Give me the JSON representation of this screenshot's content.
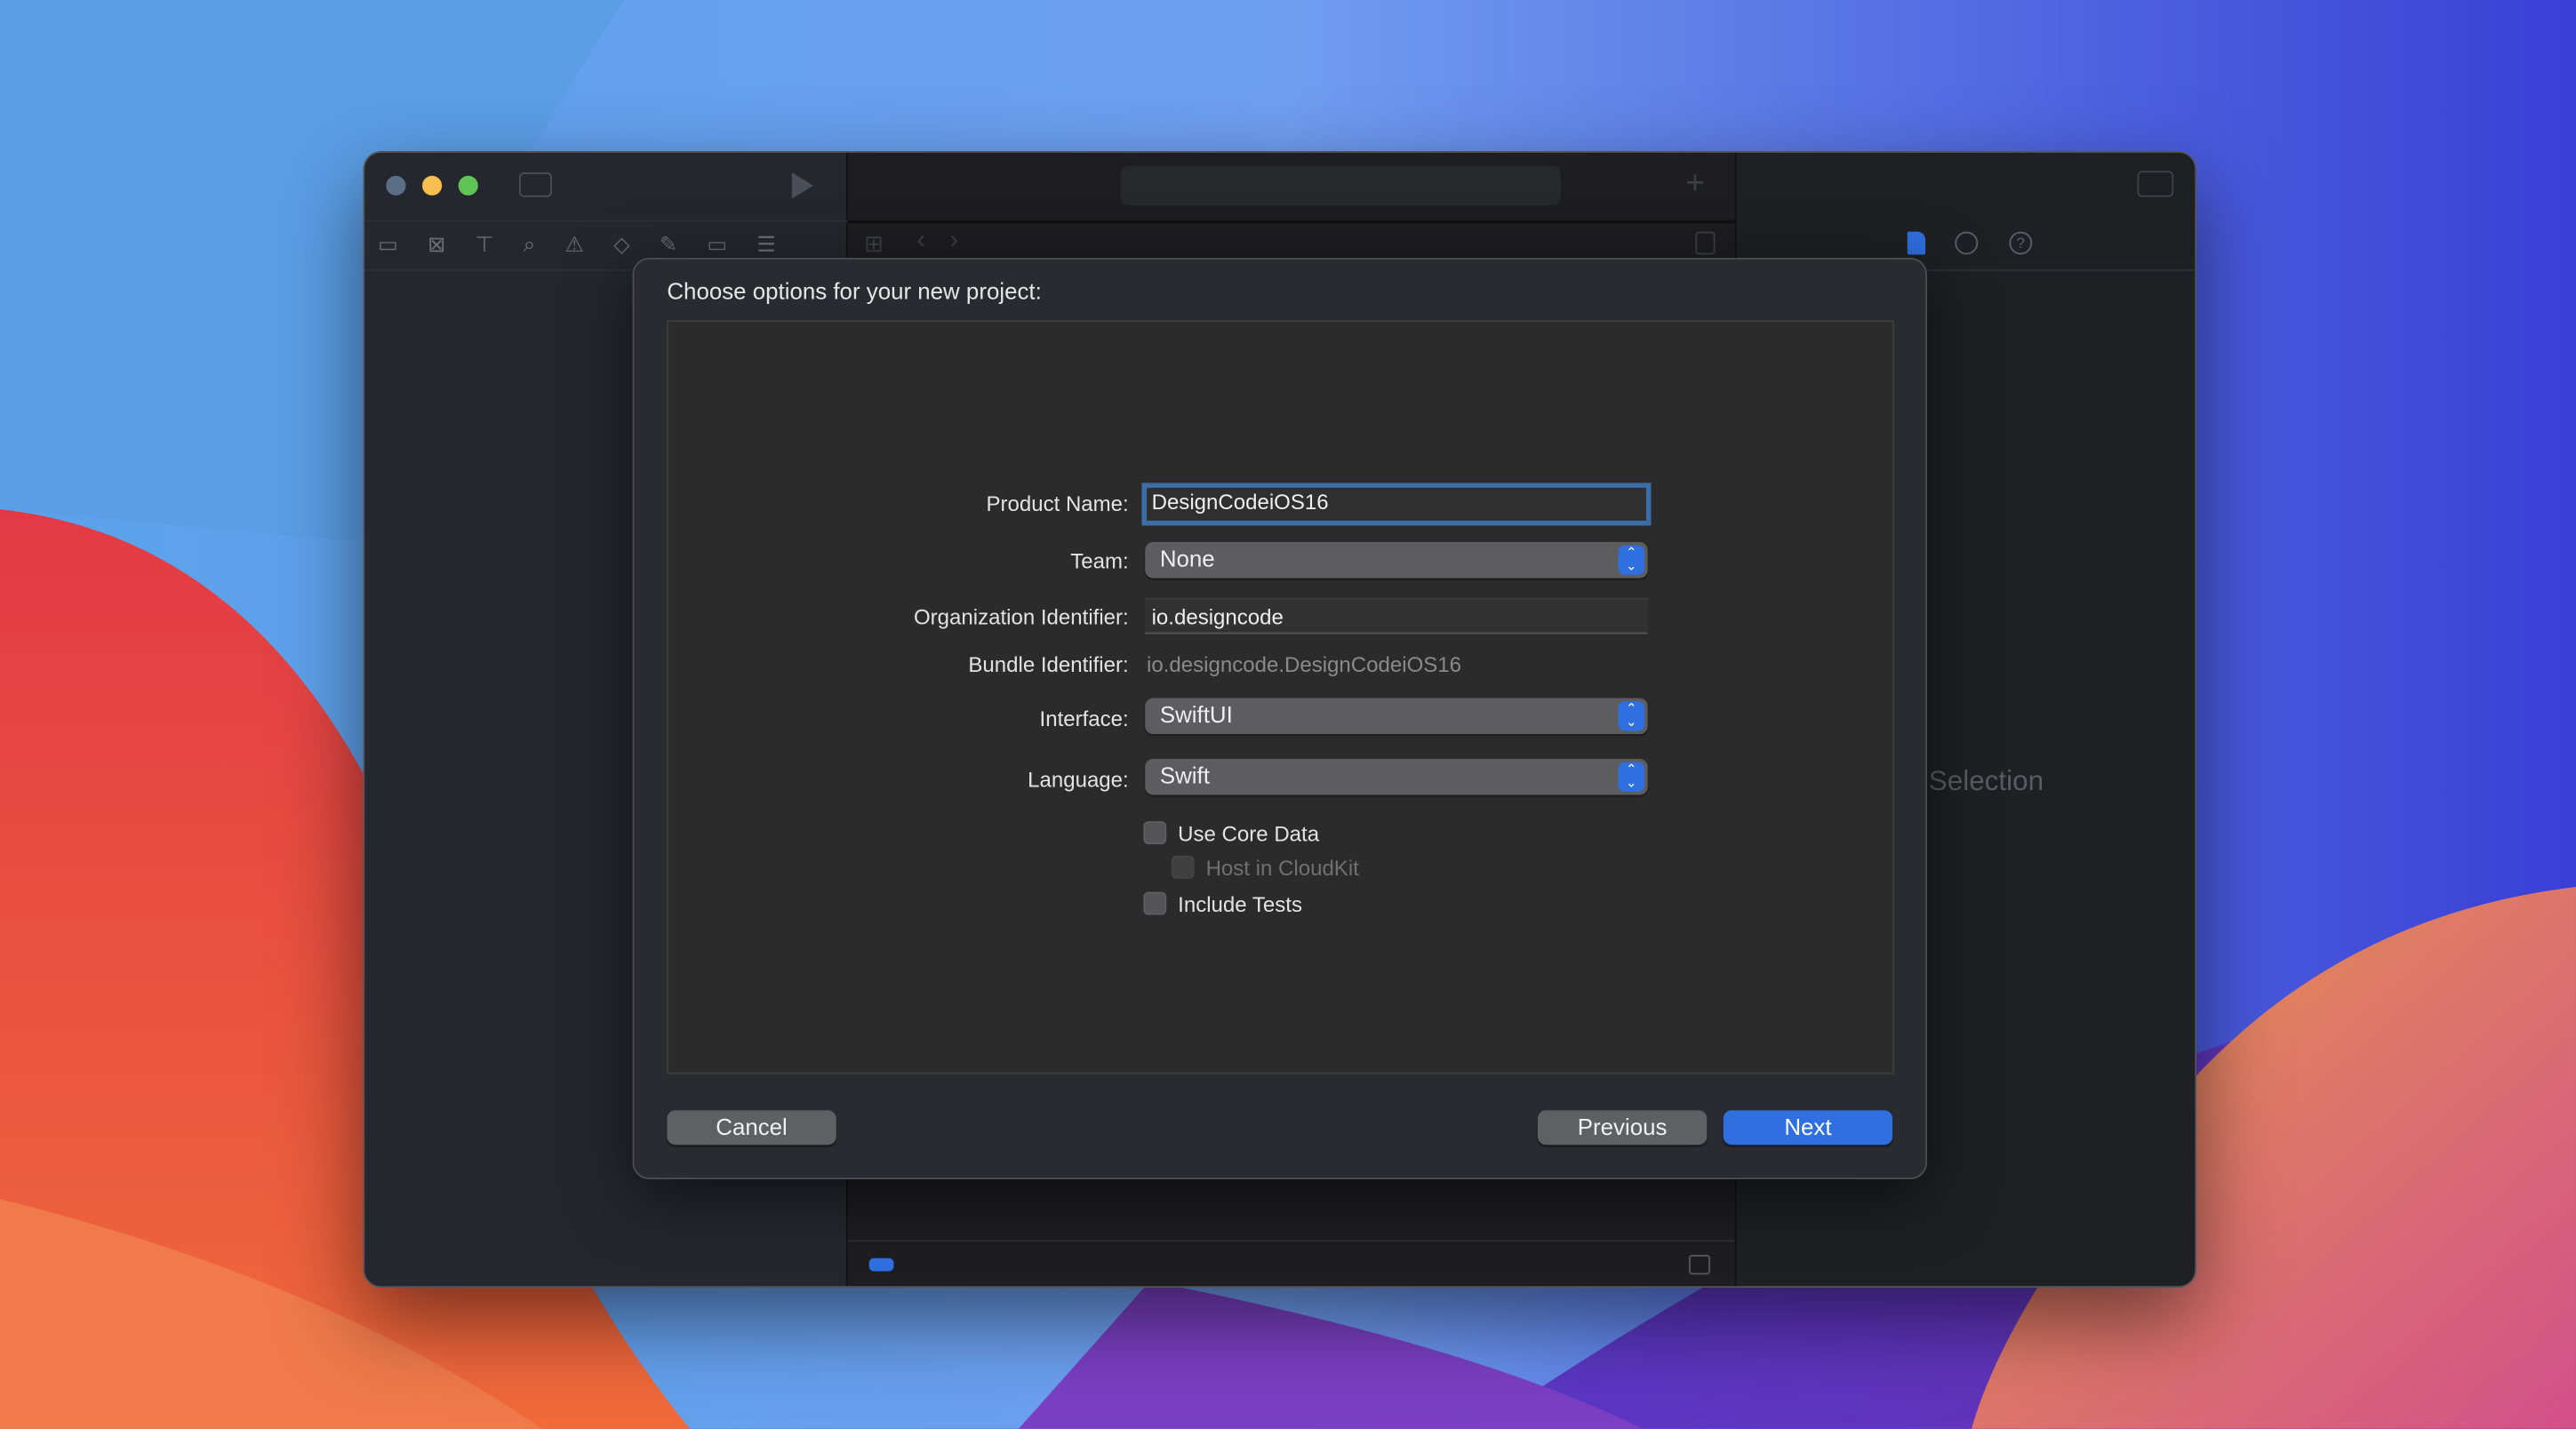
{
  "window": {
    "traffic_lights": {
      "close": "#5a6f85",
      "minimize": "#f6be4f",
      "zoom": "#5fc453"
    },
    "navigator_icons": [
      "folder-icon",
      "source-control-icon",
      "hierarchy-icon",
      "search-icon",
      "warning-icon",
      "test-diamond-icon",
      "debug-spray-icon",
      "breakpoint-icon",
      "report-icon"
    ],
    "inspector_icons": [
      "file-inspector-icon",
      "history-icon",
      "help-icon"
    ],
    "no_selection_text": "Selection"
  },
  "dialog": {
    "title": "Choose options for your new project:",
    "fields": {
      "product_name": {
        "label": "Product Name:",
        "value": "DesignCodeiOS16"
      },
      "team": {
        "label": "Team:",
        "value": "None"
      },
      "org_identifier": {
        "label": "Organization Identifier:",
        "value": "io.designcode"
      },
      "bundle_identifier": {
        "label": "Bundle Identifier:",
        "value": "io.designcode.DesignCodeiOS16"
      },
      "interface": {
        "label": "Interface:",
        "value": "SwiftUI"
      },
      "language": {
        "label": "Language:",
        "value": "Swift"
      }
    },
    "checkboxes": {
      "use_core_data": {
        "label": "Use Core Data",
        "checked": false
      },
      "host_in_cloudkit": {
        "label": "Host in CloudKit",
        "checked": false,
        "disabled": true
      },
      "include_tests": {
        "label": "Include Tests",
        "checked": false
      }
    },
    "buttons": {
      "cancel": "Cancel",
      "previous": "Previous",
      "next": "Next"
    },
    "accent": "#2f6fe0"
  }
}
